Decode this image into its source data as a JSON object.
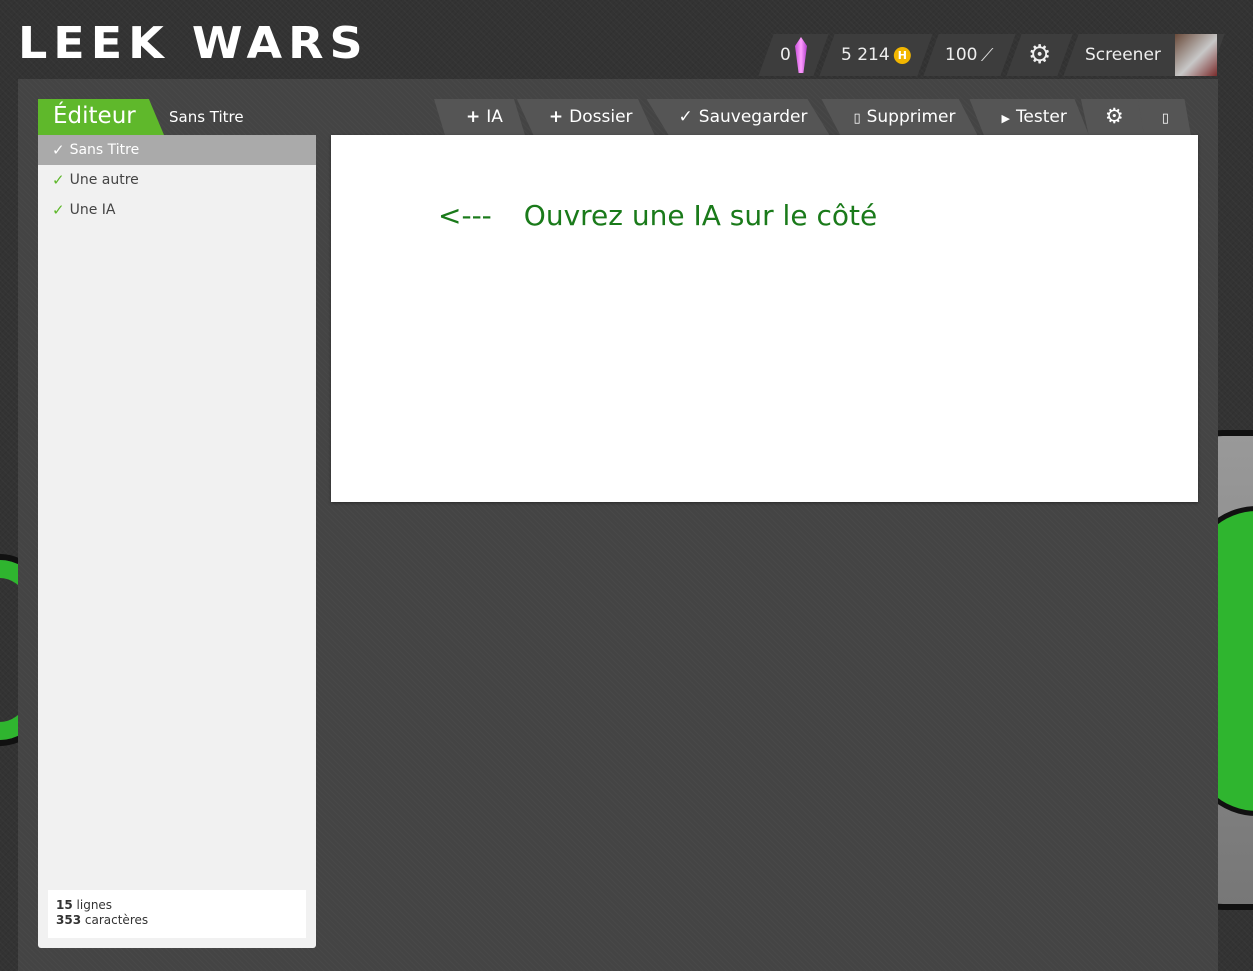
{
  "header": {
    "logo": "Leek Wars",
    "crystals": "0",
    "habs": "5 214",
    "habs_symbol": "H",
    "fights": "100",
    "username": "Screener"
  },
  "editor": {
    "title": "Éditeur",
    "current_file": "Sans Titre",
    "toolbar": {
      "new_ai": "IA",
      "new_folder": "Dossier",
      "save": "Sauvegarder",
      "delete": "Supprimer",
      "test": "Tester"
    },
    "ai_list": [
      {
        "label": "Sans Titre",
        "selected": true
      },
      {
        "label": "Une autre",
        "selected": false
      },
      {
        "label": "Une IA",
        "selected": false
      }
    ],
    "stats": {
      "lines_count": "15",
      "lines_label": "lignes",
      "chars_count": "353",
      "chars_label": "caractères"
    },
    "hint_arrow": "<---",
    "hint_text": "Ouvrez une IA sur le côté"
  },
  "colors": {
    "accent_green": "#5fb82b",
    "hint_green": "#1a7a1a",
    "background": "#333333"
  }
}
